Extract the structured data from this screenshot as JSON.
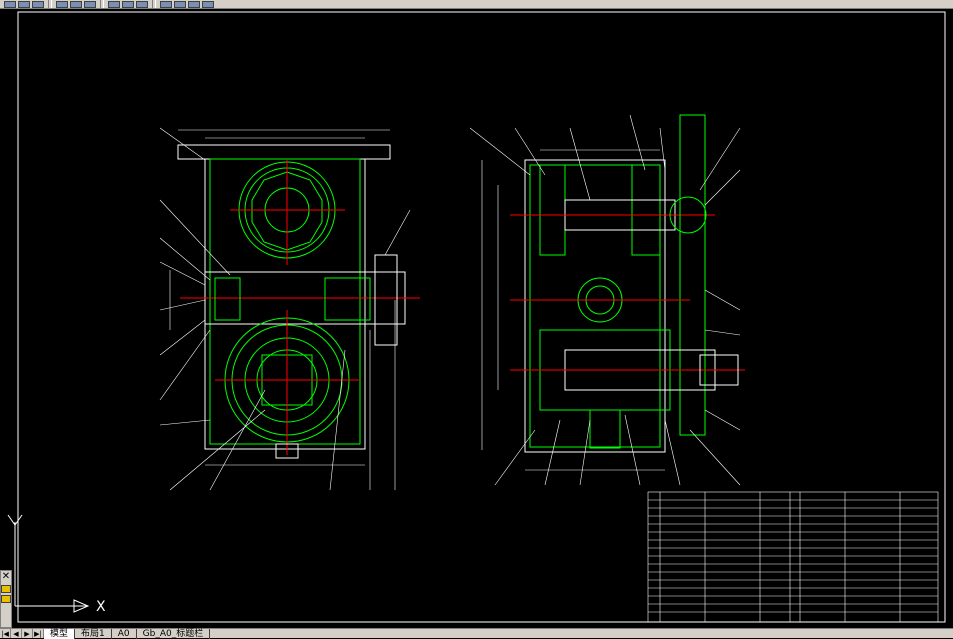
{
  "toolbar": {
    "icons": [
      "new-icon",
      "open-icon",
      "save-icon",
      "print-icon",
      "undo-icon",
      "redo-icon",
      "pan-icon",
      "zoom-icon",
      "properties-icon",
      "layer-icon",
      "text-style-icon",
      "dim-style-icon",
      "help-icon"
    ]
  },
  "tabs": {
    "nav": [
      "|◀",
      "◀",
      "▶",
      "▶|"
    ],
    "items": [
      "模型",
      "布局1",
      "A0",
      "Gb_A0_标题栏"
    ]
  },
  "ucs": {
    "x_label": "X",
    "y_label": "Y"
  },
  "colors": {
    "background": "#000000",
    "frame": "#ffffff",
    "hatch": "#00ff00",
    "dimension": "#00ff00",
    "center_line": "#ff0000",
    "leader": "#ffffff"
  }
}
